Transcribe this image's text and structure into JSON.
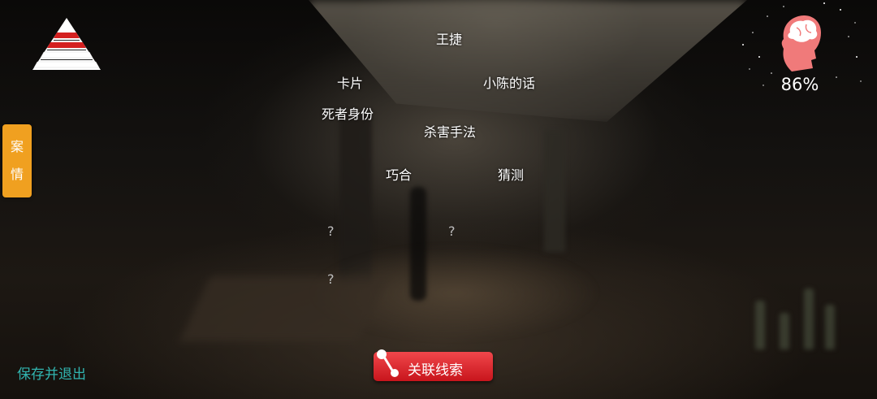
{
  "hud": {
    "case_tab": [
      "案",
      "情"
    ],
    "sanity_percent": "86%",
    "save_exit": "保存并退出",
    "link_button": "关联线索"
  },
  "clues": {
    "wang_jie": "王捷",
    "card": "卡片",
    "xiaochen_words": "小陈的话",
    "victim_identity": "死者身份",
    "kill_method": "杀害手法",
    "coincidence": "巧合",
    "guess": "猜测",
    "unknown_1": "?",
    "unknown_2": "?",
    "unknown_3": "?"
  },
  "colors": {
    "case_tab": "#f0a020",
    "brain": "#f07a7a",
    "save_exit": "#31b5b0",
    "link_button": "#d9262c"
  },
  "icons": {
    "pyramid": "level-pyramid-icon",
    "brain": "brain-head-icon",
    "link": "link-node-icon"
  }
}
